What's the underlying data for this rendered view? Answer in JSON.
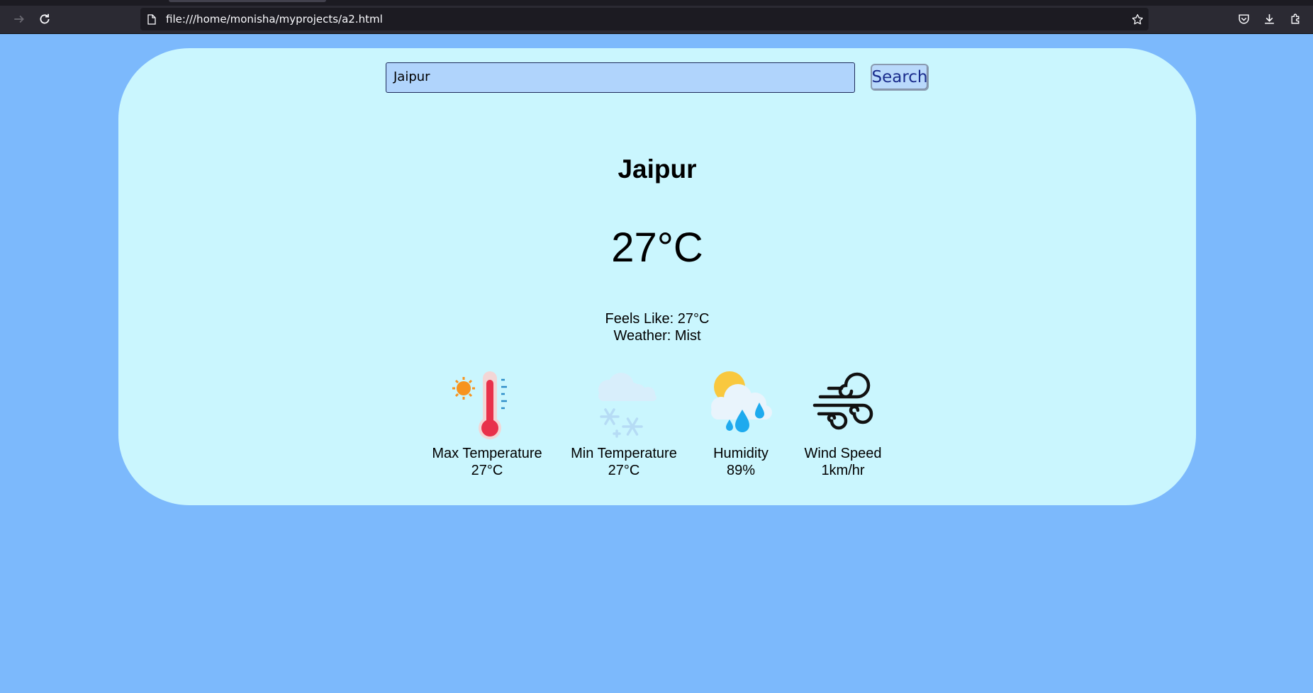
{
  "browser": {
    "url": "file:///home/monisha/myprojects/a2.html"
  },
  "search": {
    "value": "Jaipur",
    "button_label": "Search"
  },
  "weather": {
    "city": "Jaipur",
    "temperature": "27°C",
    "feels_like": "Feels Like: 27°C",
    "condition": "Weather: Mist"
  },
  "stats": [
    {
      "icon": "thermometer-hot-icon",
      "label": "Max Temperature",
      "value": "27°C"
    },
    {
      "icon": "snow-cloud-icon",
      "label": "Min Temperature",
      "value": "27°C"
    },
    {
      "icon": "rain-cloud-icon",
      "label": "Humidity",
      "value": "89%"
    },
    {
      "icon": "wind-icon",
      "label": "Wind Speed",
      "value": "1km/hr"
    }
  ],
  "colors": {
    "page_background": "#7cb9fc",
    "card_background": "#caf6fe",
    "input_background": "#b0d4fc",
    "button_text": "#1a2c8c"
  }
}
